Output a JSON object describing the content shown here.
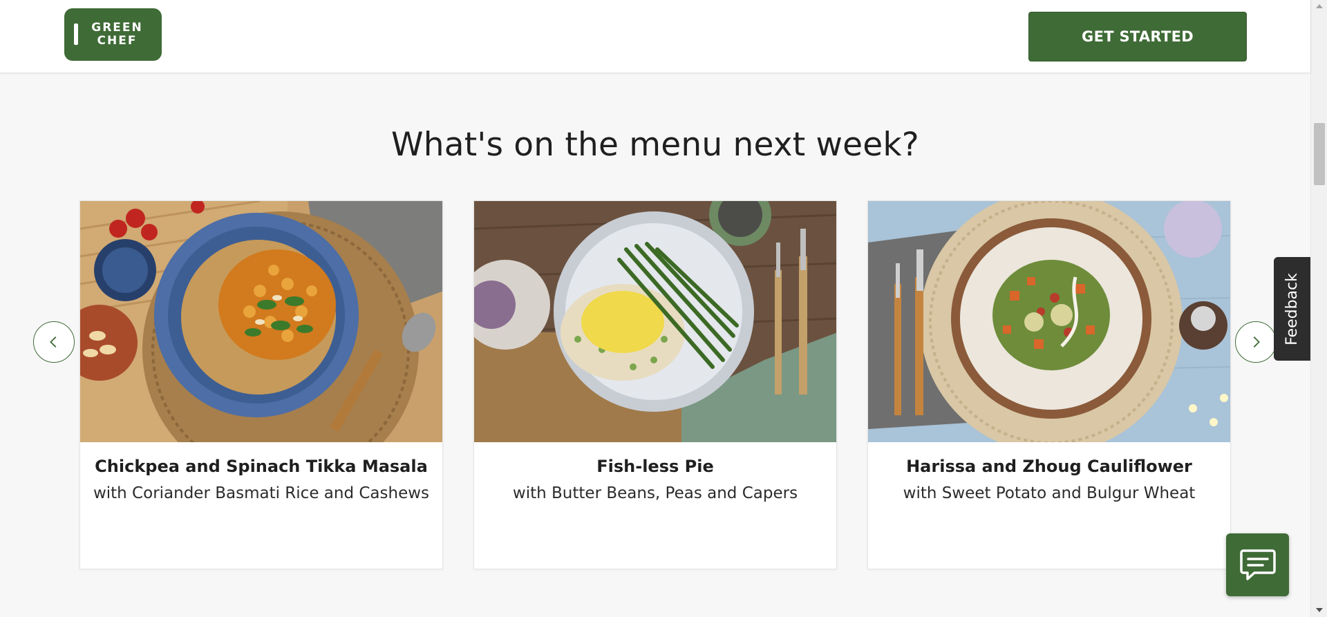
{
  "header": {
    "logo_text": "GREEN\nCHEF",
    "cta_label": "GET STARTED"
  },
  "section": {
    "title": "What's on the menu next week?"
  },
  "recipes": [
    {
      "title": "Chickpea and Spinach Tikka Masala",
      "subtitle": "with Coriander Basmati Rice and Cashews"
    },
    {
      "title": "Fish-less Pie",
      "subtitle": "with Butter Beans, Peas and Capers"
    },
    {
      "title": "Harissa and Zhoug Cauliflower",
      "subtitle": "with Sweet Potato and Bulgur Wheat"
    }
  ],
  "feedback": {
    "label": "Feedback"
  },
  "icons": {
    "prev": "chevron-left-icon",
    "next": "chevron-right-icon",
    "chat": "chat-bubble-icon"
  },
  "colors": {
    "brand_green": "#3f6b36",
    "page_background": "#f7f7f7",
    "feedback_background": "#2d2d2d"
  }
}
